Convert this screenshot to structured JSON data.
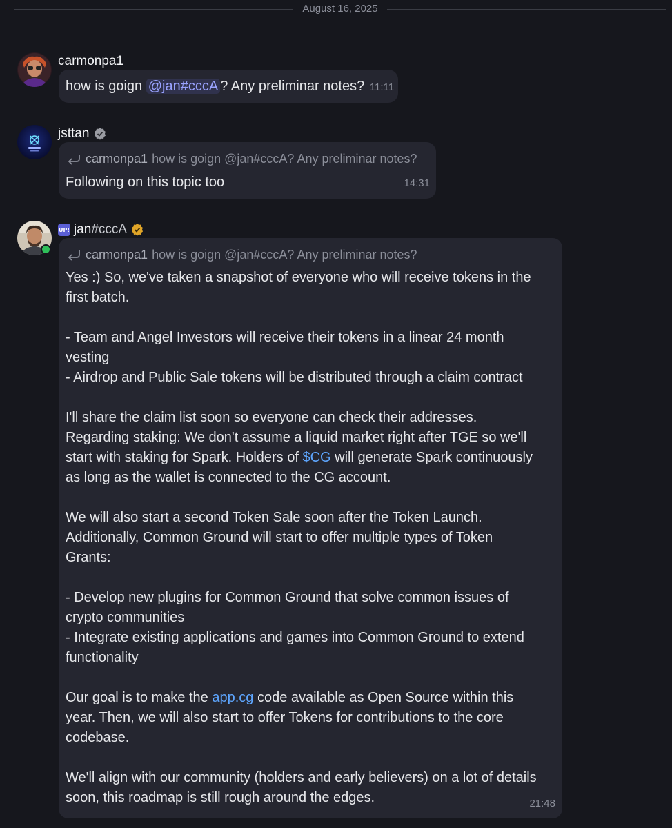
{
  "date_divider": "August 16, 2025",
  "messages": [
    {
      "username": "carmonpa1",
      "text_before": "how is goign ",
      "mention": "@jan#cccA",
      "text_after": "? Any preliminar notes?",
      "time": "11:11"
    },
    {
      "username": "jsttan",
      "reply_user": "carmonpa1",
      "reply_text": "how is goign @jan#cccA? Any preliminar notes?",
      "text": "Following on this topic too",
      "time": "14:31"
    },
    {
      "username_prefix": "jan",
      "username_suffix": "#cccA",
      "up_badge": "UP!",
      "reply_user": "carmonpa1",
      "reply_text": "how is goign @jan#cccA? Any preliminar notes?",
      "lines": {
        "l1": "Yes :) So, we've taken a snapshot of everyone who will receive tokens in the",
        "l2": "first batch.",
        "l3": "- Team and Angel Investors will receive their tokens in a linear 24 month",
        "l4": "vesting",
        "l5": "- Airdrop and Public Sale tokens will be distributed through a claim contract",
        "l6": "I'll share the claim list soon so everyone can check their addresses.",
        "l7": "Regarding staking: We don't assume a liquid market right after TGE so we'll",
        "l8": "start with staking for Spark. Holders of ",
        "l8_link": "$CG",
        "l8_after": " will generate Spark continuously",
        "l9": "as long as the wallet is connected to the CG account.",
        "l10": "We will also start a second Token Sale soon after the Token Launch.",
        "l11": "Additionally, Common Ground will start to offer multiple types of Token",
        "l12": "Grants:",
        "l13": "- Develop new plugins for Common Ground that solve common issues of",
        "l14": "crypto communities",
        "l15": "- Integrate existing applications and games into Common Ground to extend",
        "l16": "functionality",
        "l17": "Our goal is to make the ",
        "l17_link": "app.cg",
        "l17_after": " code available as Open Source within this",
        "l18": "year. Then, we will also start to offer Tokens for contributions to the core",
        "l19": "codebase.",
        "l20": "We'll align with our community (holders and early believers) on a lot of details",
        "l21": "soon, this roadmap is still rough around the edges."
      },
      "time": "21:48"
    }
  ],
  "colors": {
    "background": "#16171d",
    "bubble": "#252630",
    "mention": "#9aa3ff",
    "link": "#5ea6ff",
    "online": "#2fbf5a",
    "verified_gold": "#e0a528",
    "verified_gray": "#9a9ca3"
  },
  "icons": [
    "reply-arrow-icon",
    "verified-badge-icon",
    "up-badge-icon",
    "online-status-icon"
  ]
}
